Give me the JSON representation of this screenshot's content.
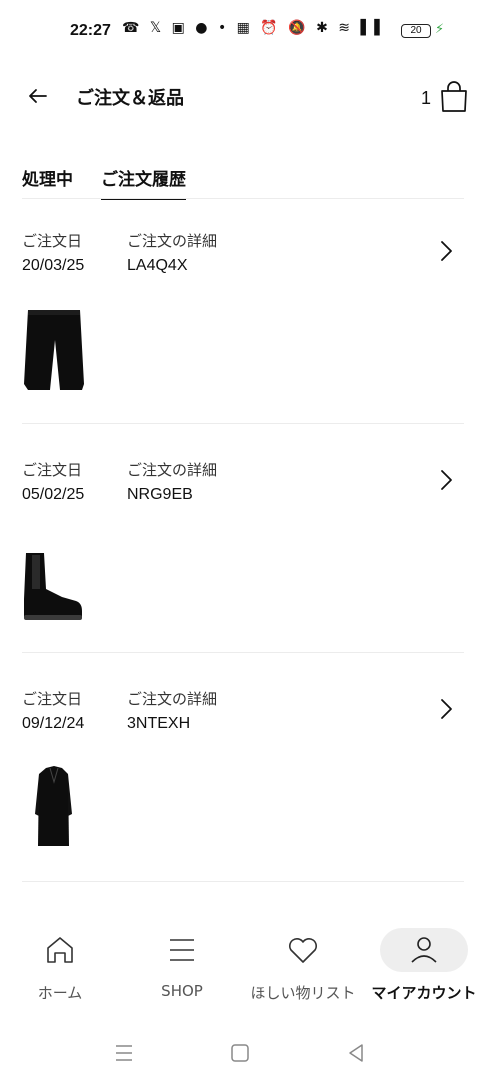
{
  "status_bar": {
    "time": "22:27",
    "icons_text": "☎ 𝕏 ▣ ● • ▦ ⏰ 🔕 ✱ ≋ ▌▌",
    "battery": "20"
  },
  "header": {
    "title": "ご注文＆返品",
    "cart_count": "1"
  },
  "tabs": [
    {
      "label": "処理中",
      "active": false
    },
    {
      "label": "ご注文履歴",
      "active": true
    }
  ],
  "orders": [
    {
      "date_label": "ご注文日",
      "date": "20/03/25",
      "detail_label": "ご注文の詳細",
      "order_id": "LA4Q4X",
      "item_icon": "shorts-icon"
    },
    {
      "date_label": "ご注文日",
      "date": "05/02/25",
      "detail_label": "ご注文の詳細",
      "order_id": "NRG9EB",
      "item_icon": "boot-icon"
    },
    {
      "date_label": "ご注文日",
      "date": "09/12/24",
      "detail_label": "ご注文の詳細",
      "order_id": "3NTEXH",
      "item_icon": "coat-icon"
    }
  ],
  "bottom_nav": [
    {
      "label": "ホーム",
      "icon": "home-icon",
      "active": false
    },
    {
      "label": "SHOP",
      "icon": "menu-icon",
      "active": false
    },
    {
      "label": "ほしい物リスト",
      "icon": "heart-icon",
      "active": false
    },
    {
      "label": "マイアカウント",
      "icon": "user-icon",
      "active": true
    }
  ],
  "colors": {
    "text": "#111111",
    "divider": "#ececec",
    "active_pill": "#eeeeee",
    "charging": "#3aa84a"
  }
}
